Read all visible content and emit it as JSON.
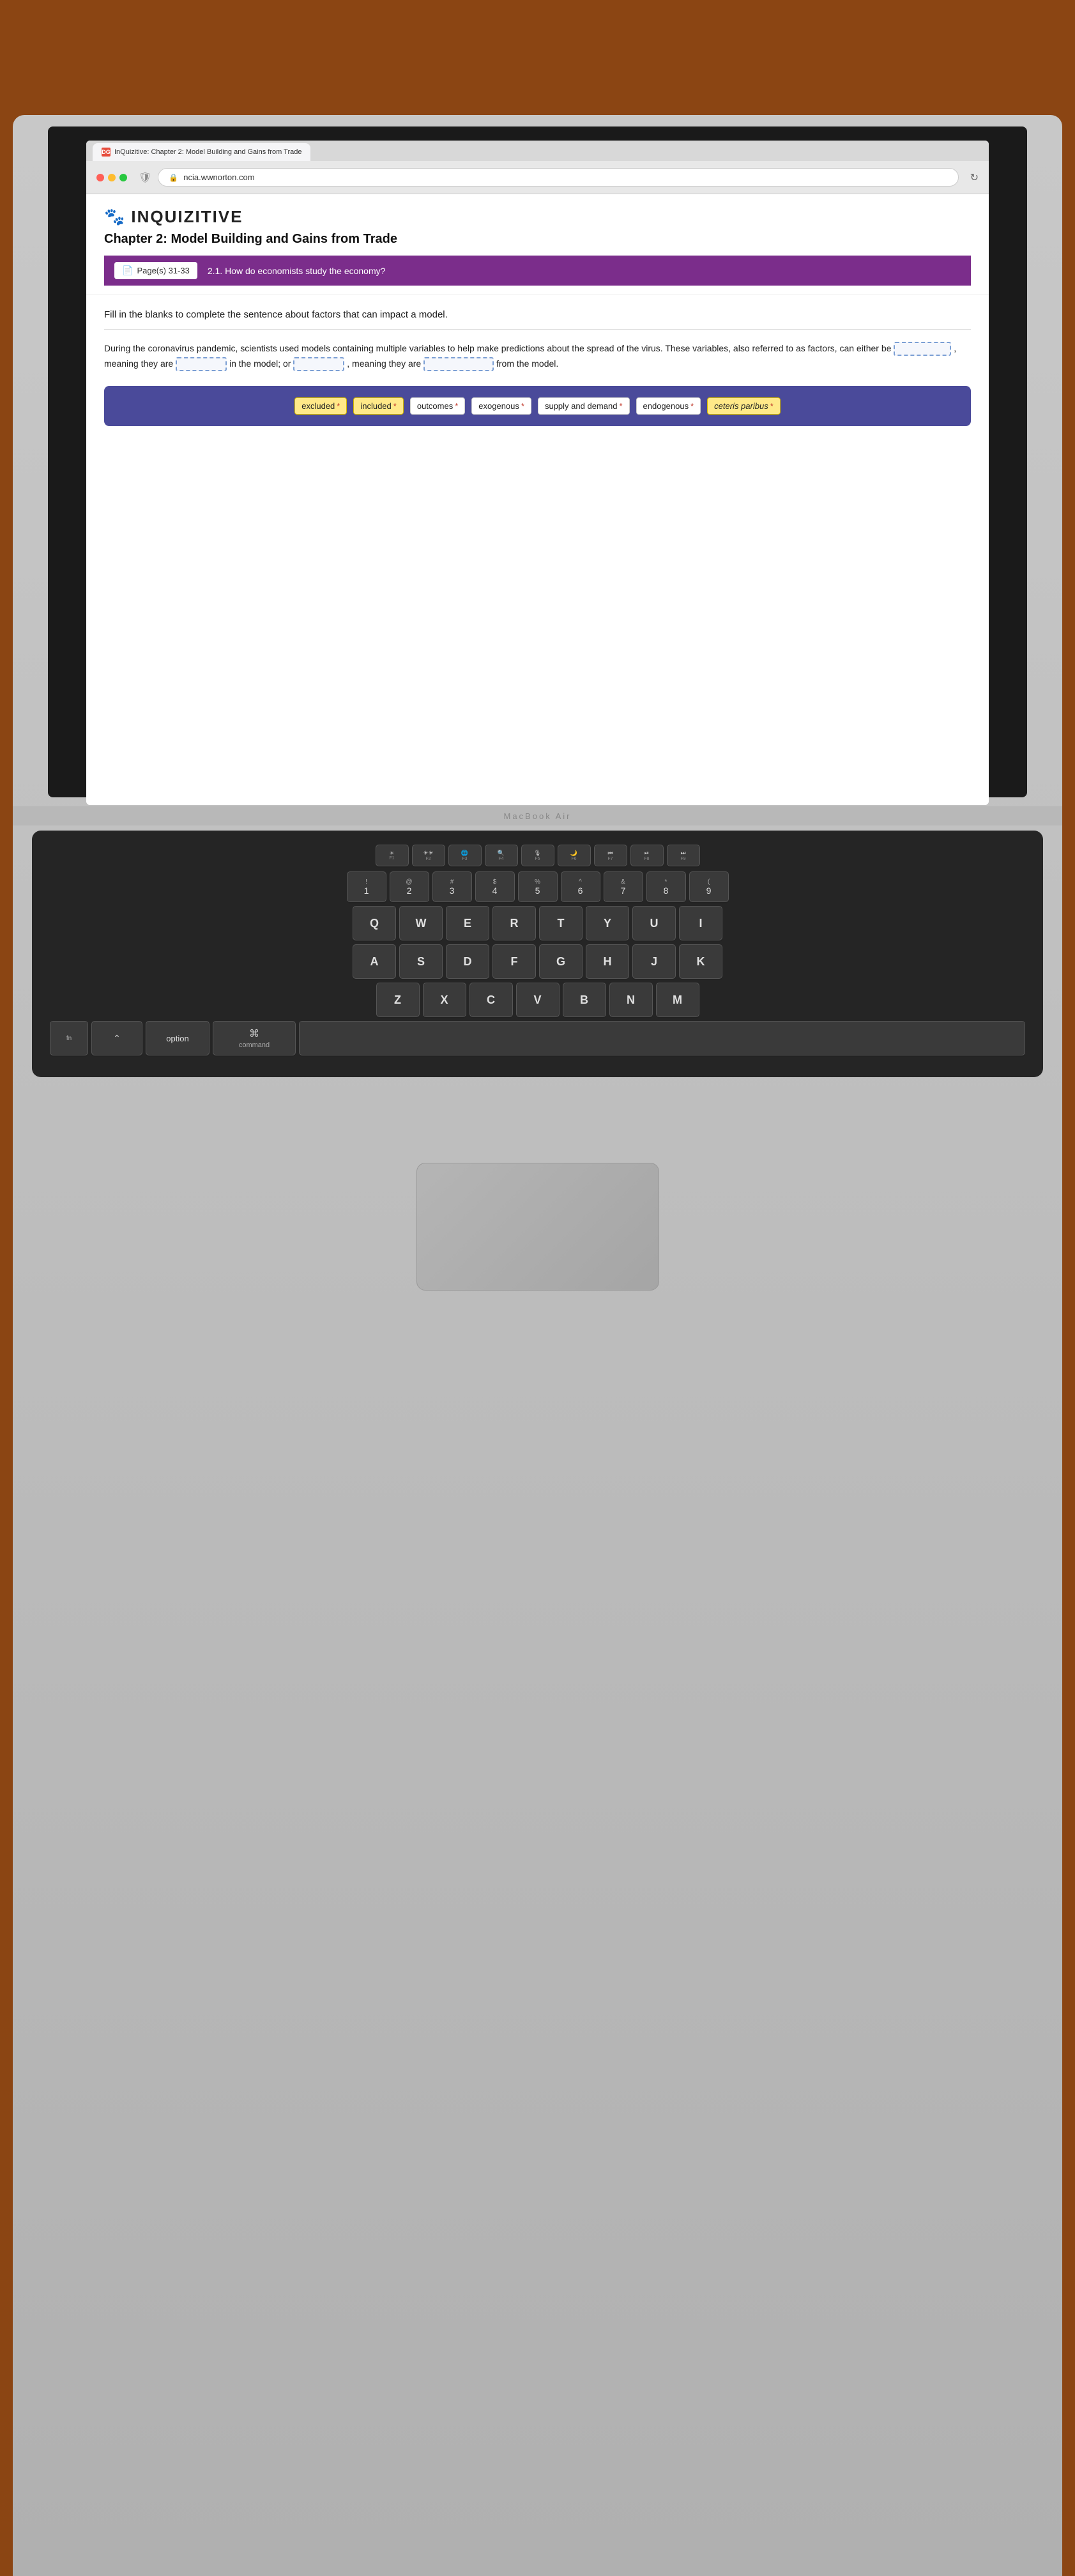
{
  "browser": {
    "url": "ncia.wwnorton.com",
    "tab_label": "InQuizitive: Chapter 2: Model Building and Gains from Trade",
    "tab_favicon": "DG"
  },
  "app": {
    "logo_icon": "🐾",
    "logo_text": "INQUIZITIVE",
    "chapter_title": "Chapter 2: Model Building and Gains from Trade"
  },
  "nav": {
    "page_badge": "Page(s) 31-33",
    "question_nav": "2.1. How do economists study the economy?"
  },
  "question": {
    "instruction": "Fill in the blanks to complete the sentence about factors that can impact a model.",
    "text_part1": "During the coronavirus pandemic, scientists used models containing multiple variables to help make predictions about the spread of the virus. These variables, also referred to as factors, can either be",
    "text_part2": ", meaning they are",
    "text_part3": "in the model; or",
    "text_part4": ", meaning they are",
    "text_part5": "from the model."
  },
  "tokens": [
    {
      "label": "excluded",
      "type": "yellow",
      "asterisk": true
    },
    {
      "label": "included",
      "type": "yellow",
      "asterisk": true
    },
    {
      "label": "outcomes",
      "type": "normal",
      "asterisk": true
    },
    {
      "label": "exogenous",
      "type": "normal",
      "asterisk": true
    },
    {
      "label": "supply and demand",
      "type": "normal",
      "asterisk": true
    },
    {
      "label": "endogenous",
      "type": "normal",
      "asterisk": true
    },
    {
      "label": "ceteris paribus",
      "type": "yellow",
      "asterisk": true
    }
  ],
  "keyboard": {
    "macbook_label": "MacBook Air",
    "fn_keys": [
      "☀",
      "☀☀",
      "🌐",
      "🔍",
      "🎤",
      "🌙",
      "◁◁",
      "▶⏸",
      "▷▷"
    ],
    "fn_labels": [
      "F1",
      "F2",
      "F3",
      "F4",
      "F5",
      "F6",
      "F7",
      "F8",
      "F9"
    ],
    "num_row": [
      {
        "top": "!",
        "bottom": "1"
      },
      {
        "top": "@",
        "bottom": "2"
      },
      {
        "top": "#",
        "bottom": "3"
      },
      {
        "top": "$",
        "bottom": "4"
      },
      {
        "top": "%",
        "bottom": "5"
      },
      {
        "top": "^",
        "bottom": "6"
      },
      {
        "top": "&",
        "bottom": "7"
      },
      {
        "top": "*",
        "bottom": "8"
      },
      {
        "top": "(",
        "bottom": "9"
      }
    ],
    "row1": [
      "Q",
      "W",
      "E",
      "R",
      "T",
      "Y",
      "U",
      "I"
    ],
    "row2": [
      "A",
      "S",
      "D",
      "F",
      "G",
      "H",
      "J",
      "K"
    ],
    "row3": [
      "Z",
      "X",
      "C",
      "V",
      "B",
      "N",
      "M"
    ],
    "bottom": {
      "option": "option",
      "command": "command"
    }
  }
}
